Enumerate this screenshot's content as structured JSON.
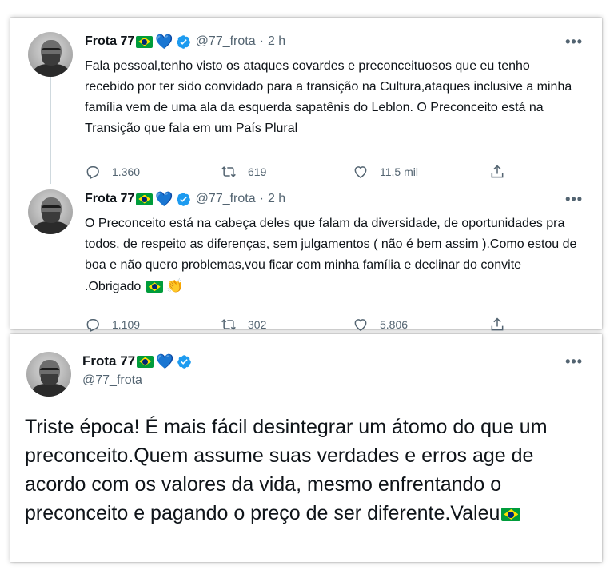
{
  "thread": {
    "tweets": [
      {
        "name": "Frota 77",
        "handle": "@77_frota",
        "separator": "·",
        "time": "2 h",
        "text": "Fala pessoal,tenho visto os ataques covardes e preconceituosos que eu tenho recebido por ter sido convidado para a transição na Cultura,ataques inclusive a minha família vem de uma ala da esquerda sapatênis do Leblon. O Preconceito está na Transição que fala em um País Plural",
        "replies": "1.360",
        "retweets": "619",
        "likes": "11,5 mil"
      },
      {
        "name": "Frota 77",
        "handle": "@77_frota",
        "separator": "·",
        "time": "2 h",
        "text": "O Preconceito está na cabeça deles que falam da diversidade, de oportunidades pra todos, de respeito as diferenças, sem julgamentos ( não é bem assim ).Como estou de boa e não quero problemas,vou ficar com minha família e declinar do convite .Obrigado",
        "replies": "1.109",
        "retweets": "302",
        "likes": "5.806"
      }
    ]
  },
  "featured": {
    "name": "Frota 77",
    "handle": "@77_frota",
    "text": "Triste época! É mais fácil desintegrar um átomo do que um preconceito.Quem assume suas verdades e erros age de acordo com os valores da vida, mesmo enfrentando o preconceito e pagando o preço de ser diferente.Valeu"
  },
  "icons": {
    "more": "•••",
    "heart_emoji": "💙",
    "clap_emoji": "👏"
  },
  "colors": {
    "verified": "#1d9bf0",
    "secondary_text": "#536471",
    "thread_line": "#cfd9de"
  }
}
